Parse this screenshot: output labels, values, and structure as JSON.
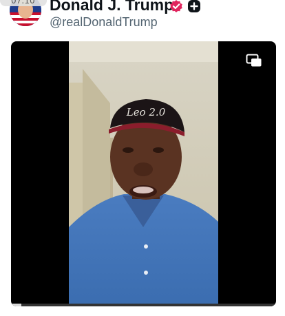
{
  "status": {
    "time": "07:10"
  },
  "profile": {
    "display_name": "Donald J. Trump",
    "handle": "@realDonaldTrump",
    "verified_icon": "verified-badge-icon",
    "add_icon": "plus-square-icon"
  },
  "video": {
    "overlay_icon": "picture-in-picture-icon",
    "cap_text": "Leo 2.0",
    "progress": 0.04
  },
  "colors": {
    "name": "#0f1419",
    "handle": "#536471",
    "verified": "#e0245e",
    "video_bg": "#000000"
  }
}
